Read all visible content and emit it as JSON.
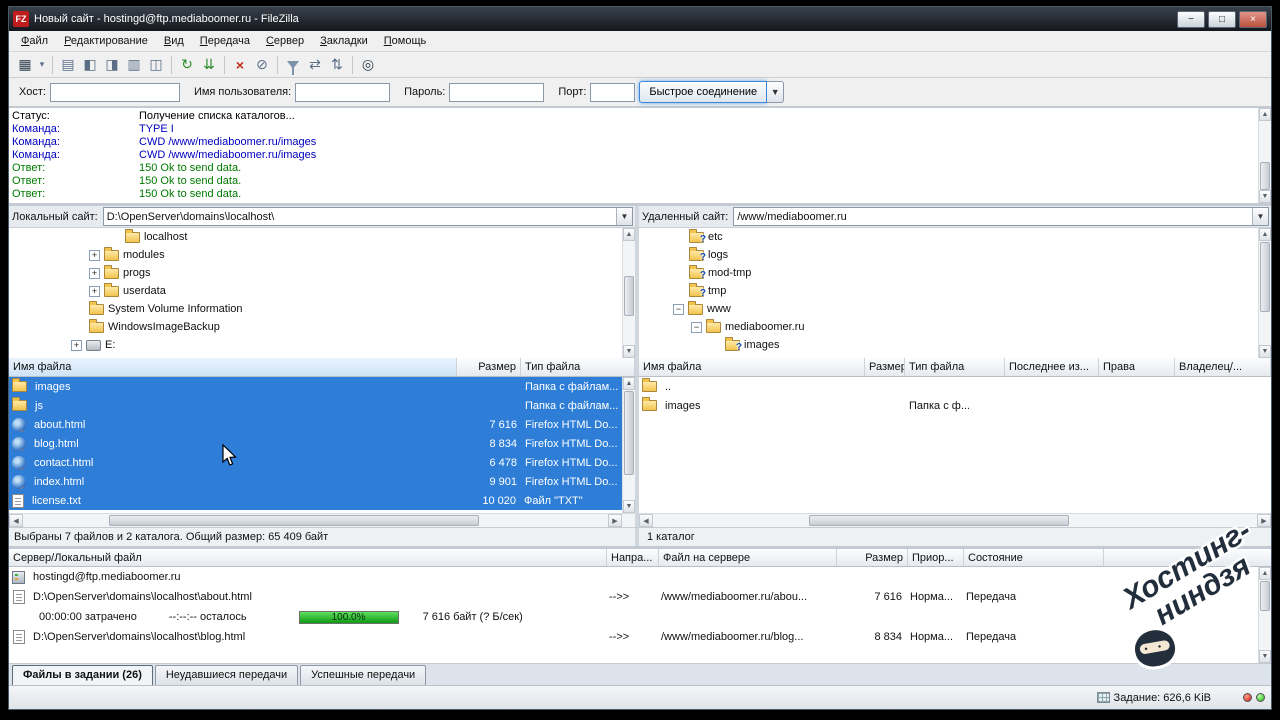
{
  "window": {
    "title": "Новый сайт - hostingd@ftp.mediaboomer.ru - FileZilla",
    "logo": "FZ"
  },
  "window_controls": {
    "minimize": "−",
    "maximize": "□",
    "close": "×"
  },
  "menu": {
    "items": [
      "Файл",
      "Редактирование",
      "Вид",
      "Передача",
      "Сервер",
      "Закладки",
      "Помощь"
    ]
  },
  "toolbar": {
    "icons": [
      "site-manager",
      "site-manager-dropdown",
      "toggle-message-log",
      "toggle-local-tree",
      "toggle-remote-tree",
      "toggle-transfer-queue",
      "toggle-directory-listing",
      "refresh",
      "process-queue",
      "cancel-operation",
      "disconnect",
      "filter",
      "directory-comparison",
      "synchronized-browsing",
      "find-files"
    ]
  },
  "quickconnect": {
    "host_label": "Хост:",
    "host_value": "",
    "user_label": "Имя пользователя:",
    "user_value": "",
    "pass_label": "Пароль:",
    "pass_value": "",
    "port_label": "Порт:",
    "port_value": "",
    "connect_label": "Быстрое соединение"
  },
  "log": {
    "lines": [
      {
        "kind": "status",
        "label": "Статус:",
        "text": "Получение списка каталогов..."
      },
      {
        "kind": "command",
        "label": "Команда:",
        "text": "TYPE I"
      },
      {
        "kind": "command",
        "label": "Команда:",
        "text": "CWD /www/mediaboomer.ru/images"
      },
      {
        "kind": "command",
        "label": "Команда:",
        "text": "CWD /www/mediaboomer.ru/images"
      },
      {
        "kind": "response",
        "label": "Ответ:",
        "text": "150 Ok to send data."
      },
      {
        "kind": "response",
        "label": "Ответ:",
        "text": "150 Ok to send data."
      },
      {
        "kind": "response",
        "label": "Ответ:",
        "text": "150 Ok to send data."
      }
    ]
  },
  "local": {
    "site_label": "Локальный сайт:",
    "path": "D:\\OpenServer\\domains\\localhost\\",
    "tree": [
      {
        "label": "localhost"
      },
      {
        "label": "modules"
      },
      {
        "label": "progs"
      },
      {
        "label": "userdata"
      },
      {
        "label": "System Volume Information"
      },
      {
        "label": "WindowsImageBackup"
      },
      {
        "label": "E:"
      }
    ],
    "columns": [
      "Имя файла",
      "Размер",
      "Тип файла"
    ],
    "files": [
      {
        "name": "images",
        "size": "",
        "type": "Папка с файлам..."
      },
      {
        "name": "js",
        "size": "",
        "type": "Папка с файлам..."
      },
      {
        "name": "about.html",
        "size": "7 616",
        "type": "Firefox HTML Do..."
      },
      {
        "name": "blog.html",
        "size": "8 834",
        "type": "Firefox HTML Do..."
      },
      {
        "name": "contact.html",
        "size": "6 478",
        "type": "Firefox HTML Do..."
      },
      {
        "name": "index.html",
        "size": "9 901",
        "type": "Firefox HTML Do..."
      },
      {
        "name": "license.txt",
        "size": "10 020",
        "type": "Файл \"TXT\""
      }
    ],
    "status": "Выбраны 7 файлов и 2 каталога. Общий размер: 65 409 байт"
  },
  "remote": {
    "site_label": "Удаленный сайт:",
    "path": "/www/mediaboomer.ru",
    "tree": [
      {
        "label": "etc"
      },
      {
        "label": "logs"
      },
      {
        "label": "mod-tmp"
      },
      {
        "label": "tmp"
      },
      {
        "label": "www"
      },
      {
        "label": "mediaboomer.ru"
      },
      {
        "label": "images"
      }
    ],
    "columns": [
      "Имя файла",
      "Размер",
      "Тип файла",
      "Последнее из...",
      "Права",
      "Владелец/..."
    ],
    "files": [
      {
        "name": "..",
        "size": "",
        "type": ""
      },
      {
        "name": "images",
        "size": "",
        "type": "Папка с ф..."
      }
    ],
    "status": "1 каталог"
  },
  "queue": {
    "columns": [
      "Сервер/Локальный файл",
      "Напра...",
      "Файл на сервере",
      "Размер",
      "Приор...",
      "Состояние"
    ],
    "rows": [
      {
        "kind": "server",
        "text": "hostingd@ftp.mediaboomer.ru"
      },
      {
        "kind": "file",
        "local": "D:\\OpenServer\\domains\\localhost\\about.html",
        "dir": "-->>",
        "remote": "/www/mediaboomer.ru/abou...",
        "size": "7 616",
        "priority": "Норма...",
        "status": "Передача"
      },
      {
        "kind": "progress",
        "elapsed": "00:00:00 затрачено",
        "remaining": "--:--:-- осталось",
        "percent": "100.0%",
        "detail": "7 616 байт (? Б/сек)"
      },
      {
        "kind": "file",
        "local": "D:\\OpenServer\\domains\\localhost\\blog.html",
        "dir": "-->>",
        "remote": "/www/mediaboomer.ru/blog...",
        "size": "8 834",
        "priority": "Норма...",
        "status": "Передача"
      }
    ],
    "tabs": [
      "Файлы в задании (26)",
      "Неудавшиеся передачи",
      "Успешные передачи"
    ]
  },
  "statusbar": {
    "queue_size": "Задание: 626,6 KiB"
  },
  "watermark": {
    "line1": "Хостинг-",
    "line2": "ниндзя"
  },
  "colors": {
    "selection": "#2e7ed8",
    "log_command": "#0000c0",
    "log_response": "#007a00",
    "progress_green": "#18a818",
    "titlebar": "#1a2028",
    "folder_yellow": "#f2c44d"
  }
}
